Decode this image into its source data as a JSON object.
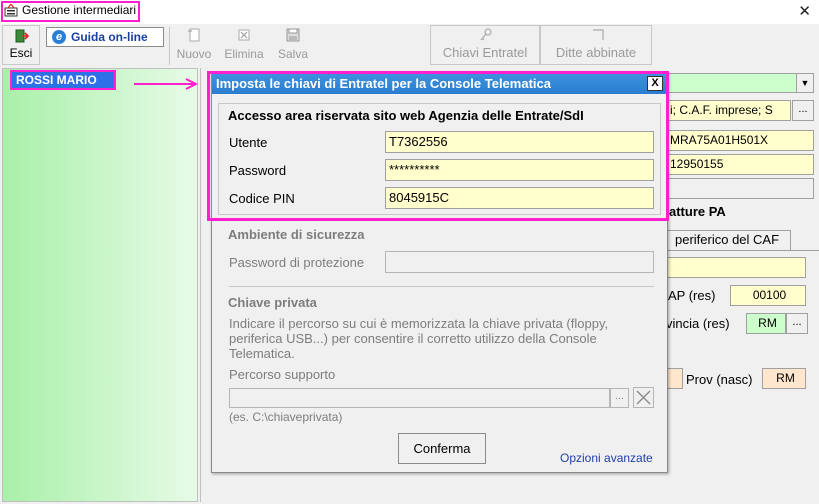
{
  "window": {
    "title": "Gestione intermediari",
    "close_glyph": "✕"
  },
  "toolbar": {
    "esci": "Esci",
    "guida": "Guida on-line",
    "nuovo": "Nuovo",
    "elimina": "Elimina",
    "salva": "Salva",
    "chiavi": "Chiavi Entratel",
    "ditte": "Ditte abbinate"
  },
  "list": {
    "selected": "ROSSI MARIO"
  },
  "background": {
    "field1": "i; C.A.F. imprese; S",
    "field2": "MRA75A01H501X",
    "field3": "12950155",
    "section": "atture PA",
    "tab": "periferico del CAF",
    "cap_label": "AP (res)",
    "cap_value": "00100",
    "prov_res_label": "vincia (res)",
    "prov_res_value": "RM",
    "prov_nasc_label": "Prov (nasc)",
    "prov_nasc_value": "RM",
    "dots": "..."
  },
  "dialog": {
    "title": "Imposta le chiavi di Entratel per la Console Telematica",
    "close": "X",
    "access": {
      "title": "Accesso area riservata sito web Agenzia delle Entrate/SdI",
      "utente_label": "Utente",
      "utente_value": "T7362556",
      "password_label": "Password",
      "password_value": "**********",
      "pin_label": "Codice PIN",
      "pin_value": "8045915C"
    },
    "security": {
      "title": "Ambiente di sicurezza",
      "password_label": "Password di protezione"
    },
    "private_key": {
      "title": "Chiave privata",
      "description": "Indicare il percorso su cui è memorizzata la chiave privata (floppy, periferica USB...) per consentire il corretto utilizzo della Console Telematica.",
      "path_label": "Percorso supporto",
      "dots": "...",
      "example": "(es. C:\\chiaveprivata)"
    },
    "confirm": "Conferma",
    "advanced": "Opzioni avanzate"
  },
  "colors": {
    "highlight": "#ff1fce",
    "dialog_title_bg": "#3f93df",
    "field_bg": "#fffecc",
    "selected_bg": "#2f6fe8",
    "list_bg": "#a9f0a9"
  }
}
